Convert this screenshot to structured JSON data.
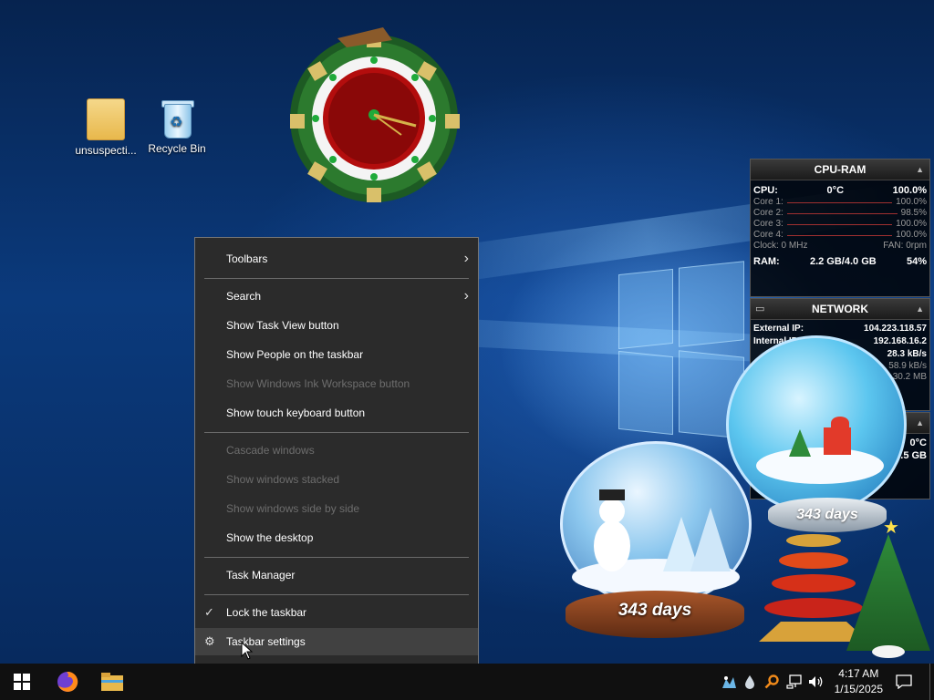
{
  "desktop": {
    "icons": [
      {
        "label": "unsuspecti..."
      },
      {
        "label": "Recycle Bin"
      }
    ]
  },
  "gadgets": {
    "cpu_ram": {
      "title": "CPU-RAM",
      "cpu_label": "CPU:",
      "cpu_temp": "0°C",
      "cpu_value": "100.0%",
      "cores": [
        {
          "label": "Core 1:",
          "value": "100.0%"
        },
        {
          "label": "Core 2:",
          "value": "98.5%"
        },
        {
          "label": "Core 3:",
          "value": "100.0%"
        },
        {
          "label": "Core 4:",
          "value": "100.0%"
        }
      ],
      "clock": "Clock: 0 MHz",
      "fan": "FAN: 0rpm",
      "ram_label": "RAM:",
      "ram_value": "2.2 GB/4.0 GB",
      "ram_percent": "54%"
    },
    "network": {
      "title": "NETWORK",
      "external_ip_label": "External IP:",
      "external_ip": "104.223.118.57",
      "internal_ip_label": "Internal IP:",
      "internal_ip": "192.168.16.2",
      "rate1": "28.3 kB/s",
      "rate2": "58.9 kB/s",
      "total": "30.2 MB"
    },
    "third": {
      "temp": "0°C",
      "mem": "9.5 GB"
    }
  },
  "snow_globes": {
    "left_days": "343 days",
    "right_days": "343 days"
  },
  "context_menu": {
    "toolbars": "Toolbars",
    "search": "Search",
    "show_task_view": "Show Task View button",
    "show_people": "Show People on the taskbar",
    "show_ink": "Show Windows Ink Workspace button",
    "show_touch_keyboard": "Show touch keyboard button",
    "cascade": "Cascade windows",
    "stacked": "Show windows stacked",
    "side_by_side": "Show windows side by side",
    "show_desktop": "Show the desktop",
    "task_manager": "Task Manager",
    "lock_taskbar": "Lock the taskbar",
    "taskbar_settings": "Taskbar settings"
  },
  "taskbar": {
    "time": "4:17 AM",
    "date": "1/15/2025"
  },
  "colors": {
    "menu_bg": "#2b2b2b",
    "taskbar_bg": "#101010",
    "accent_red": "#c21b1b"
  }
}
